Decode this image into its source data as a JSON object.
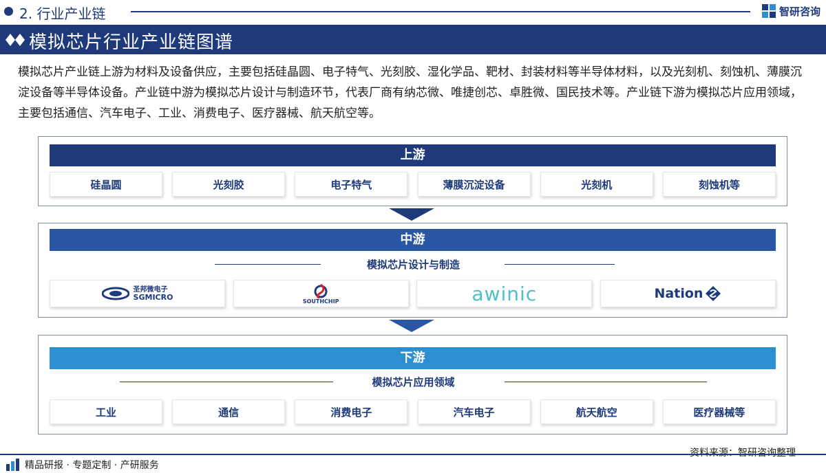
{
  "header": {
    "section": "2. 行业产业链",
    "brand": "智研咨询",
    "title": "模拟芯片行业产业链图谱"
  },
  "intro": "模拟芯片产业链上游为材料及设备供应，主要包括硅晶圆、电子特气、光刻胶、湿化学品、靶材、封装材料等半导体材料，以及光刻机、刻蚀机、薄膜沉淀设备等半导体设备。产业链中游为模拟芯片设计与制造环节，代表厂商有纳芯微、唯捷创芯、卓胜微、国民技术等。产业链下游为模拟芯片应用领域，主要包括通信、汽车电子、工业、消费电子、医疗器械、航天航空等。",
  "upstream": {
    "title": "上游",
    "items": [
      "硅晶圆",
      "光刻胶",
      "电子特气",
      "薄膜沉淀设备",
      "光刻机",
      "刻蚀机等"
    ]
  },
  "midstream": {
    "title": "中游",
    "subtitle": "模拟芯片设计与制造",
    "logos": [
      {
        "line1": "圣邦微电子",
        "line2": "SGMICRO"
      },
      {
        "line1": "SOUTHCHIP"
      },
      {
        "line1": "awinic"
      },
      {
        "line1": "Nation"
      }
    ]
  },
  "downstream": {
    "title": "下游",
    "subtitle": "模拟芯片应用领域",
    "items": [
      "工业",
      "通信",
      "消费电子",
      "汽车电子",
      "航天航空",
      "医疗器械等"
    ]
  },
  "source": "资料来源：智研咨询整理",
  "footer": "精品研报 · 专题定制 · 产研服务",
  "colors": {
    "navy": "#1f3a7a",
    "mid_blue": "#2a57a5",
    "light_blue": "#2d8fd0",
    "awinic": "#4fbfc8",
    "southchip_red": "#d4232b"
  }
}
